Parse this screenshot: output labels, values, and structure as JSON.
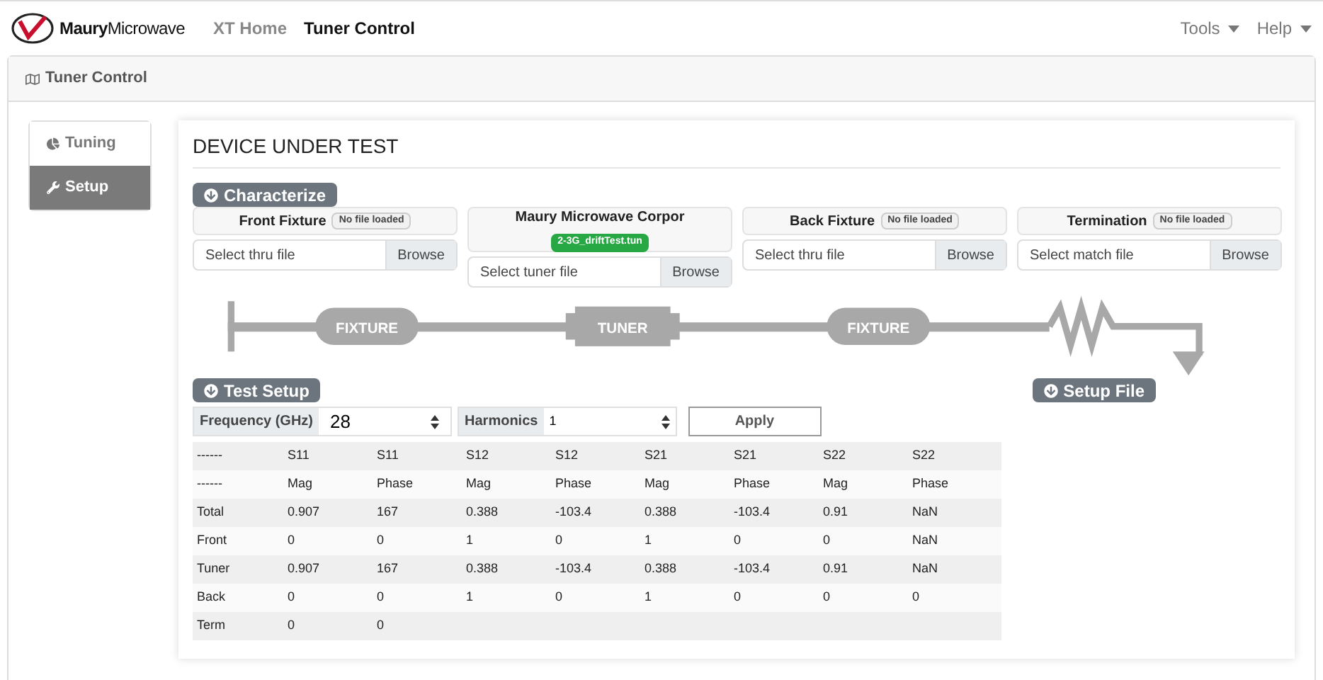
{
  "navbar": {
    "brand": {
      "bold": "Maury",
      "rest": "Microwave"
    },
    "links": [
      {
        "label": "XT Home",
        "selected": false
      },
      {
        "label": "Tuner Control",
        "selected": true
      }
    ],
    "menus": [
      "Tools",
      "Help"
    ]
  },
  "header": {
    "title": "Tuner Control"
  },
  "sidebar": {
    "items": [
      {
        "label": "Tuning",
        "selected": false
      },
      {
        "label": "Setup",
        "selected": true
      }
    ]
  },
  "section_title": "DEVICE UNDER TEST",
  "characterize_button": "Characterize",
  "blocks": [
    {
      "title": "Front Fixture",
      "badge": "No file loaded",
      "kind": "empty",
      "placeholder": "Select thru file",
      "button": "Browse"
    },
    {
      "title": "Maury Microwave Corpor",
      "badge": "2-3G_driftTest.tun",
      "kind": "loaded",
      "placeholder": "Select tuner file",
      "button": "Browse"
    },
    {
      "title": "Back Fixture",
      "badge": "No file loaded",
      "kind": "empty",
      "placeholder": "Select thru file",
      "button": "Browse"
    },
    {
      "title": "Termination",
      "badge": "No file loaded",
      "kind": "empty",
      "placeholder": "Select match file",
      "button": "Browse"
    }
  ],
  "diagram": {
    "labels": [
      "FIXTURE",
      "TUNER",
      "FIXTURE"
    ]
  },
  "test_setup_button": "Test Setup",
  "setup_file_button": "Setup File",
  "frequency": {
    "label": "Frequency (GHz)",
    "value": "28"
  },
  "harmonics": {
    "label": "Harmonics",
    "value": "1"
  },
  "apply_button": "Apply",
  "table": {
    "rows": [
      [
        "------",
        "S11",
        "S11",
        "S12",
        "S12",
        "S21",
        "S21",
        "S22",
        "S22"
      ],
      [
        "------",
        "Mag",
        "Phase",
        "Mag",
        "Phase",
        "Mag",
        "Phase",
        "Mag",
        "Phase"
      ],
      [
        "Total",
        "0.907",
        "167",
        "0.388",
        "-103.4",
        "0.388",
        "-103.4",
        "0.91",
        "NaN"
      ],
      [
        "Front",
        "0",
        "0",
        "1",
        "0",
        "1",
        "0",
        "0",
        "NaN"
      ],
      [
        "Tuner",
        "0.907",
        "167",
        "0.388",
        "-103.4",
        "0.388",
        "-103.4",
        "0.91",
        "NaN"
      ],
      [
        "Back",
        "0",
        "0",
        "1",
        "0",
        "1",
        "0",
        "0",
        "0"
      ],
      [
        "Term",
        "0",
        "0"
      ]
    ]
  }
}
